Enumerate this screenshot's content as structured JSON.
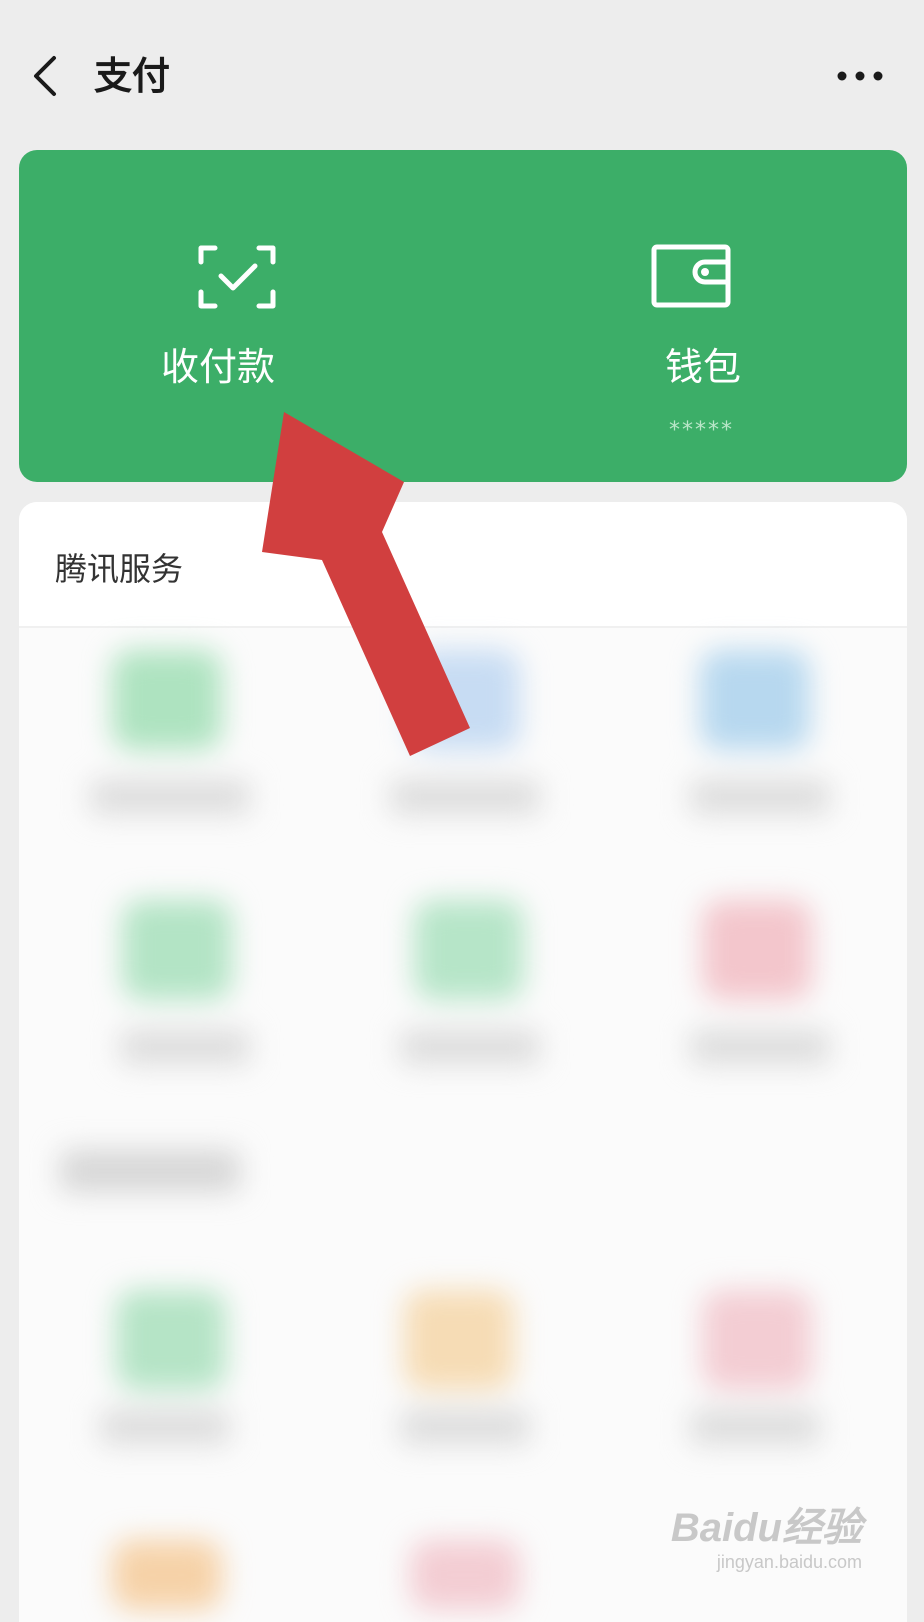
{
  "header": {
    "title": "支付",
    "back_icon": "chevron-left-icon",
    "more_icon": "more-dots-icon"
  },
  "banner": {
    "color": "#3cae68",
    "pay": {
      "label": "收付款",
      "icon": "scan-check-icon"
    },
    "wallet": {
      "label": "钱包",
      "sub": "*****",
      "icon": "wallet-icon"
    }
  },
  "services": {
    "title": "腾讯服务"
  },
  "annotation": {
    "arrow_color": "#d13f3f"
  },
  "watermark": {
    "brand": "Baidu经验",
    "url": "jingyan.baidu.com"
  }
}
